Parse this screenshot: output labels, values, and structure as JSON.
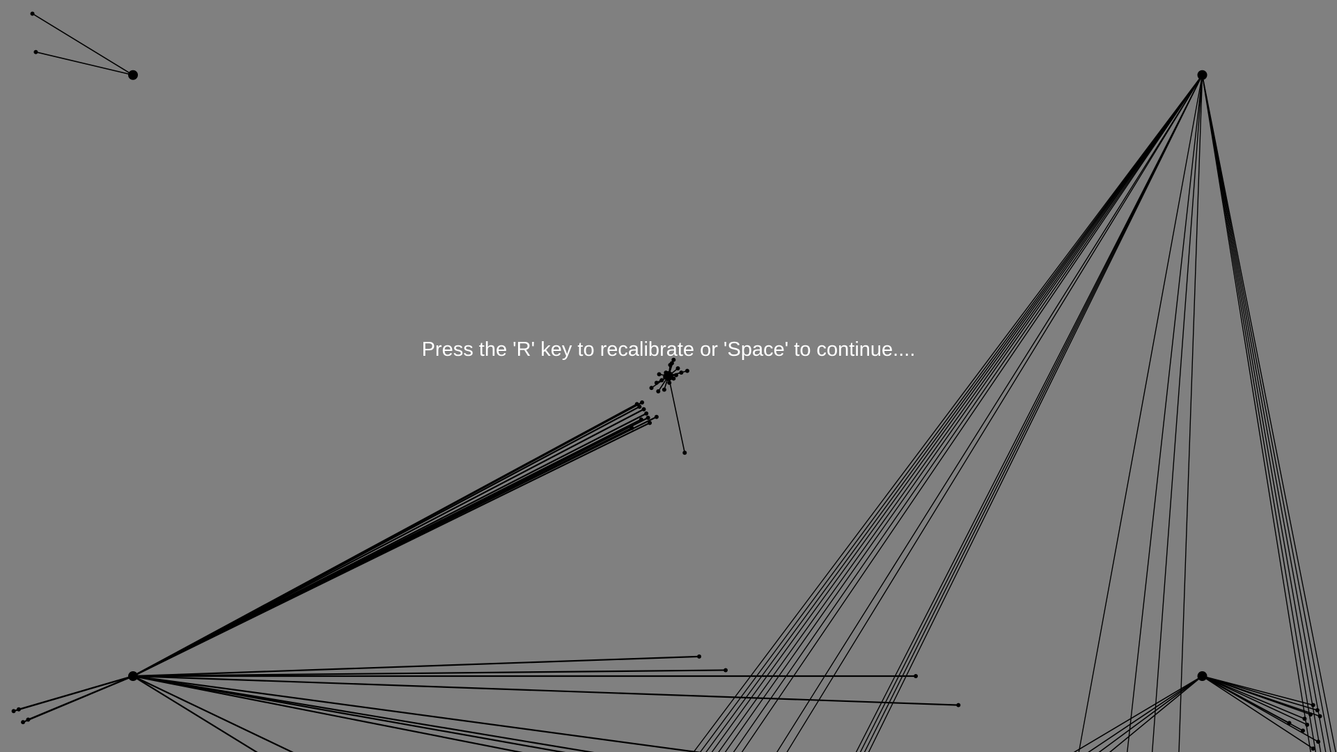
{
  "instruction": {
    "text": "Press the 'R' key to recalibrate or 'Space' to continue...."
  },
  "colors": {
    "background": "#808080",
    "text": "#ffffff",
    "marks": "#000000"
  },
  "calibration": {
    "target_count": 5,
    "target_names": [
      "top-left",
      "top-right",
      "center",
      "bottom-left",
      "bottom-right"
    ]
  }
}
